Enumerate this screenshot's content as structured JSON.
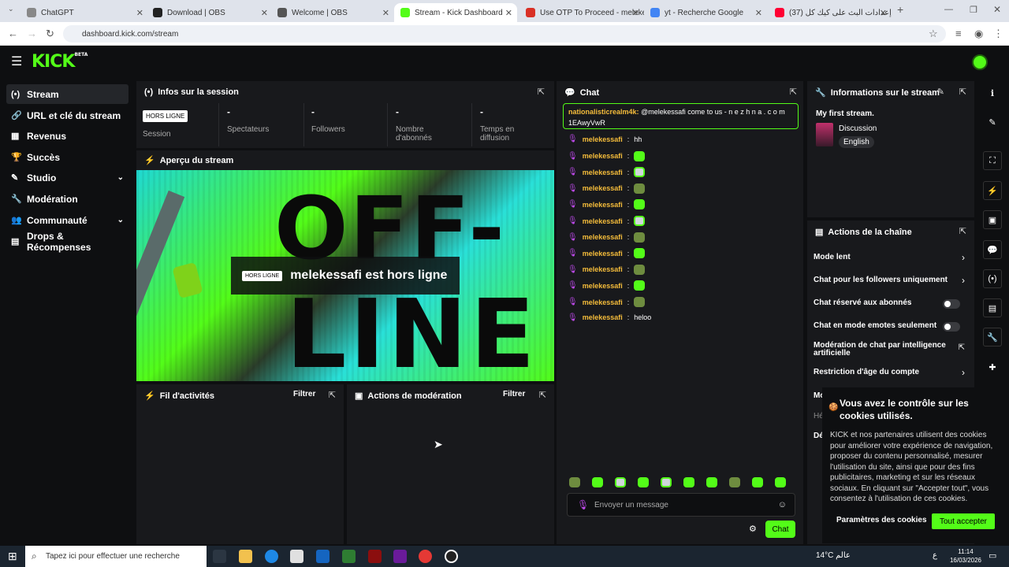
{
  "browser": {
    "tabs": [
      {
        "label": "ChatGPT",
        "color": "#888"
      },
      {
        "label": "Download | OBS",
        "color": "#222"
      },
      {
        "label": "Welcome | OBS",
        "color": "#555"
      },
      {
        "label": "Stream - Kick Dashboard",
        "color": "#53fc18"
      },
      {
        "label": "Use OTP To Proceed - melekess",
        "color": "#d93025"
      },
      {
        "label": "yt - Recherche Google",
        "color": "#4285f4"
      },
      {
        "label": "(37) إعدادات البث على كيك كل",
        "color": "#ff0033"
      }
    ],
    "url": "dashboard.kick.com/stream"
  },
  "app": {
    "logo": "KICK",
    "beta": "BETA"
  },
  "sidebar": {
    "items": [
      {
        "label": "Stream",
        "icon": "(•)"
      },
      {
        "label": "URL et clé du stream",
        "icon": "🔗"
      },
      {
        "label": "Revenus",
        "icon": "▦"
      },
      {
        "label": "Succès",
        "icon": "🏆"
      },
      {
        "label": "Studio",
        "icon": "✎"
      },
      {
        "label": "Modération",
        "icon": "🔧"
      },
      {
        "label": "Communauté",
        "icon": "👥"
      },
      {
        "label": "Drops & Récompenses",
        "icon": "▤"
      }
    ]
  },
  "session": {
    "title": "Infos sur la session",
    "badge": "HORS LIGNE",
    "session_label": "Session",
    "stats": [
      {
        "value": "-",
        "label": "Spectateurs"
      },
      {
        "value": "-",
        "label": "Followers"
      },
      {
        "value": "-",
        "label": "Nombre d'abonnés"
      },
      {
        "value": "-",
        "label": "Temps en diffusion"
      }
    ]
  },
  "preview": {
    "title": "Aperçu du stream",
    "badge": "HORS LIGNE",
    "status": "melekessafi est hors ligne",
    "art_top": "OFF-",
    "art_bottom": "LINE"
  },
  "activity": {
    "title": "Fil d'activités",
    "filter": "Filtrer"
  },
  "modactions": {
    "title": "Actions de modération",
    "filter": "Filtrer"
  },
  "chat": {
    "title": "Chat",
    "pinned_user": "nationalisticrealm4k:",
    "pinned_text": "@melekessafi come to us - n e z h n a . c o m 1EAwyVwR",
    "messages": [
      {
        "user": "melekessafi",
        "text": "hh",
        "emote": ""
      },
      {
        "user": "melekessafi",
        "text": "",
        "emote": "a"
      },
      {
        "user": "melekessafi",
        "text": "",
        "emote": "c"
      },
      {
        "user": "melekessafi",
        "text": "",
        "emote": "b"
      },
      {
        "user": "melekessafi",
        "text": "",
        "emote": "a"
      },
      {
        "user": "melekessafi",
        "text": "",
        "emote": "c"
      },
      {
        "user": "melekessafi",
        "text": "",
        "emote": "b"
      },
      {
        "user": "melekessafi",
        "text": "",
        "emote": "a"
      },
      {
        "user": "melekessafi",
        "text": "",
        "emote": "b"
      },
      {
        "user": "melekessafi",
        "text": "",
        "emote": "a"
      },
      {
        "user": "melekessafi",
        "text": "",
        "emote": "b"
      },
      {
        "user": "melekessafi",
        "text": "heloo",
        "emote": ""
      }
    ],
    "input_placeholder": "Envoyer un message",
    "send": "Chat"
  },
  "streaminfo": {
    "title": "Informations sur le stream",
    "stream_title": "My first stream.",
    "category": "Discussion",
    "language": "English"
  },
  "channel_actions": {
    "title": "Actions de la chaîne",
    "items": [
      {
        "label": "Mode lent",
        "kind": "arrow"
      },
      {
        "label": "Chat pour les followers uniquement",
        "kind": "arrow"
      },
      {
        "label": "Chat réservé aux abonnés",
        "kind": "toggle"
      },
      {
        "label": "Chat en mode emotes seulement",
        "kind": "toggle"
      },
      {
        "label": "Modération de chat par intelligence artificielle",
        "kind": "link"
      },
      {
        "label": "Restriction d'âge du compte",
        "kind": "arrow"
      }
    ],
    "partial": [
      "Mo",
      "Hé",
      "Dé"
    ]
  },
  "cookie": {
    "title": "Vous avez le contrôle sur les cookies utilisés.",
    "text": "KICK et nos partenaires utilisent des cookies pour améliorer votre expérience de navigation, proposer du contenu personnalisé, mesurer l'utilisation du site, ainsi que pour des fins publicitaires, marketing et sur les réseaux sociaux. En cliquant sur \"Accepter tout\", vous consentez à l'utilisation de ces cookies.",
    "settings": "Paramètres des cookies",
    "accept": "Tout accepter"
  },
  "taskbar": {
    "search": "Tapez ici pour effectuer une recherche",
    "weather": "14°C  عالم",
    "time": "11:14",
    "date": "16/03/2026",
    "lang": "ع"
  }
}
